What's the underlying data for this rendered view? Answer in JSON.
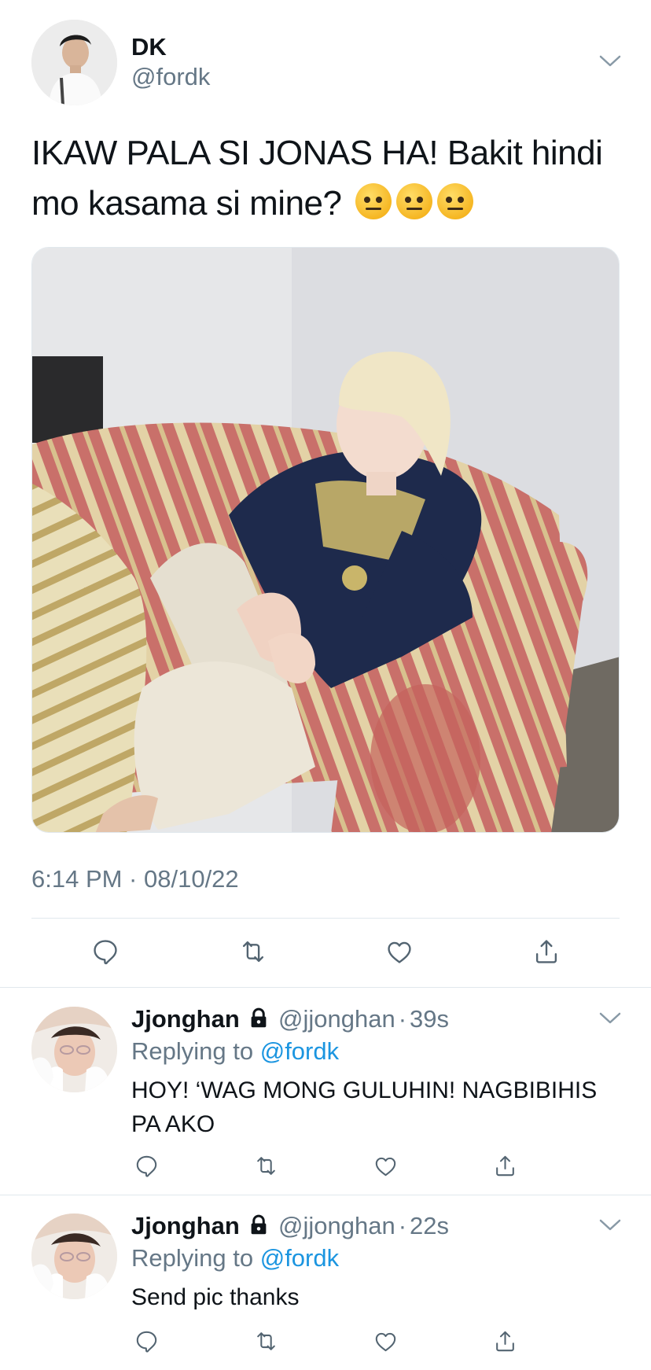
{
  "main_tweet": {
    "author_name": "DK",
    "author_handle": "@fordk",
    "text": "IKAW PALA SI JONAS HA! Bakit hindi mo kasama si mine?",
    "emoji": [
      "raised-eyebrow-emoji",
      "raised-eyebrow-emoji",
      "raised-eyebrow-emoji"
    ],
    "timestamp": "6:14 PM · 08/10/22",
    "actions": [
      "reply-icon",
      "retweet-icon",
      "like-icon",
      "share-icon"
    ]
  },
  "replies": [
    {
      "author_name": "Jjonghan",
      "author_handle": "@jjonghan",
      "time": "39s",
      "separator": "·",
      "replying_prefix": "Replying to",
      "replying_to": "@fordk",
      "text": "HOY! ‘WAG MONG GULUHIN! NAGBIBIHIS PA AKO"
    },
    {
      "author_name": "Jjonghan",
      "author_handle": "@jjonghan",
      "time": "22s",
      "separator": "·",
      "replying_prefix": "Replying to",
      "replying_to": "@fordk",
      "text": "Send pic thanks"
    }
  ],
  "colors": {
    "text": "#0f1419",
    "secondary": "#657786",
    "link": "#1b95e0",
    "divider": "#e1e8ed",
    "icon": "#536471"
  }
}
